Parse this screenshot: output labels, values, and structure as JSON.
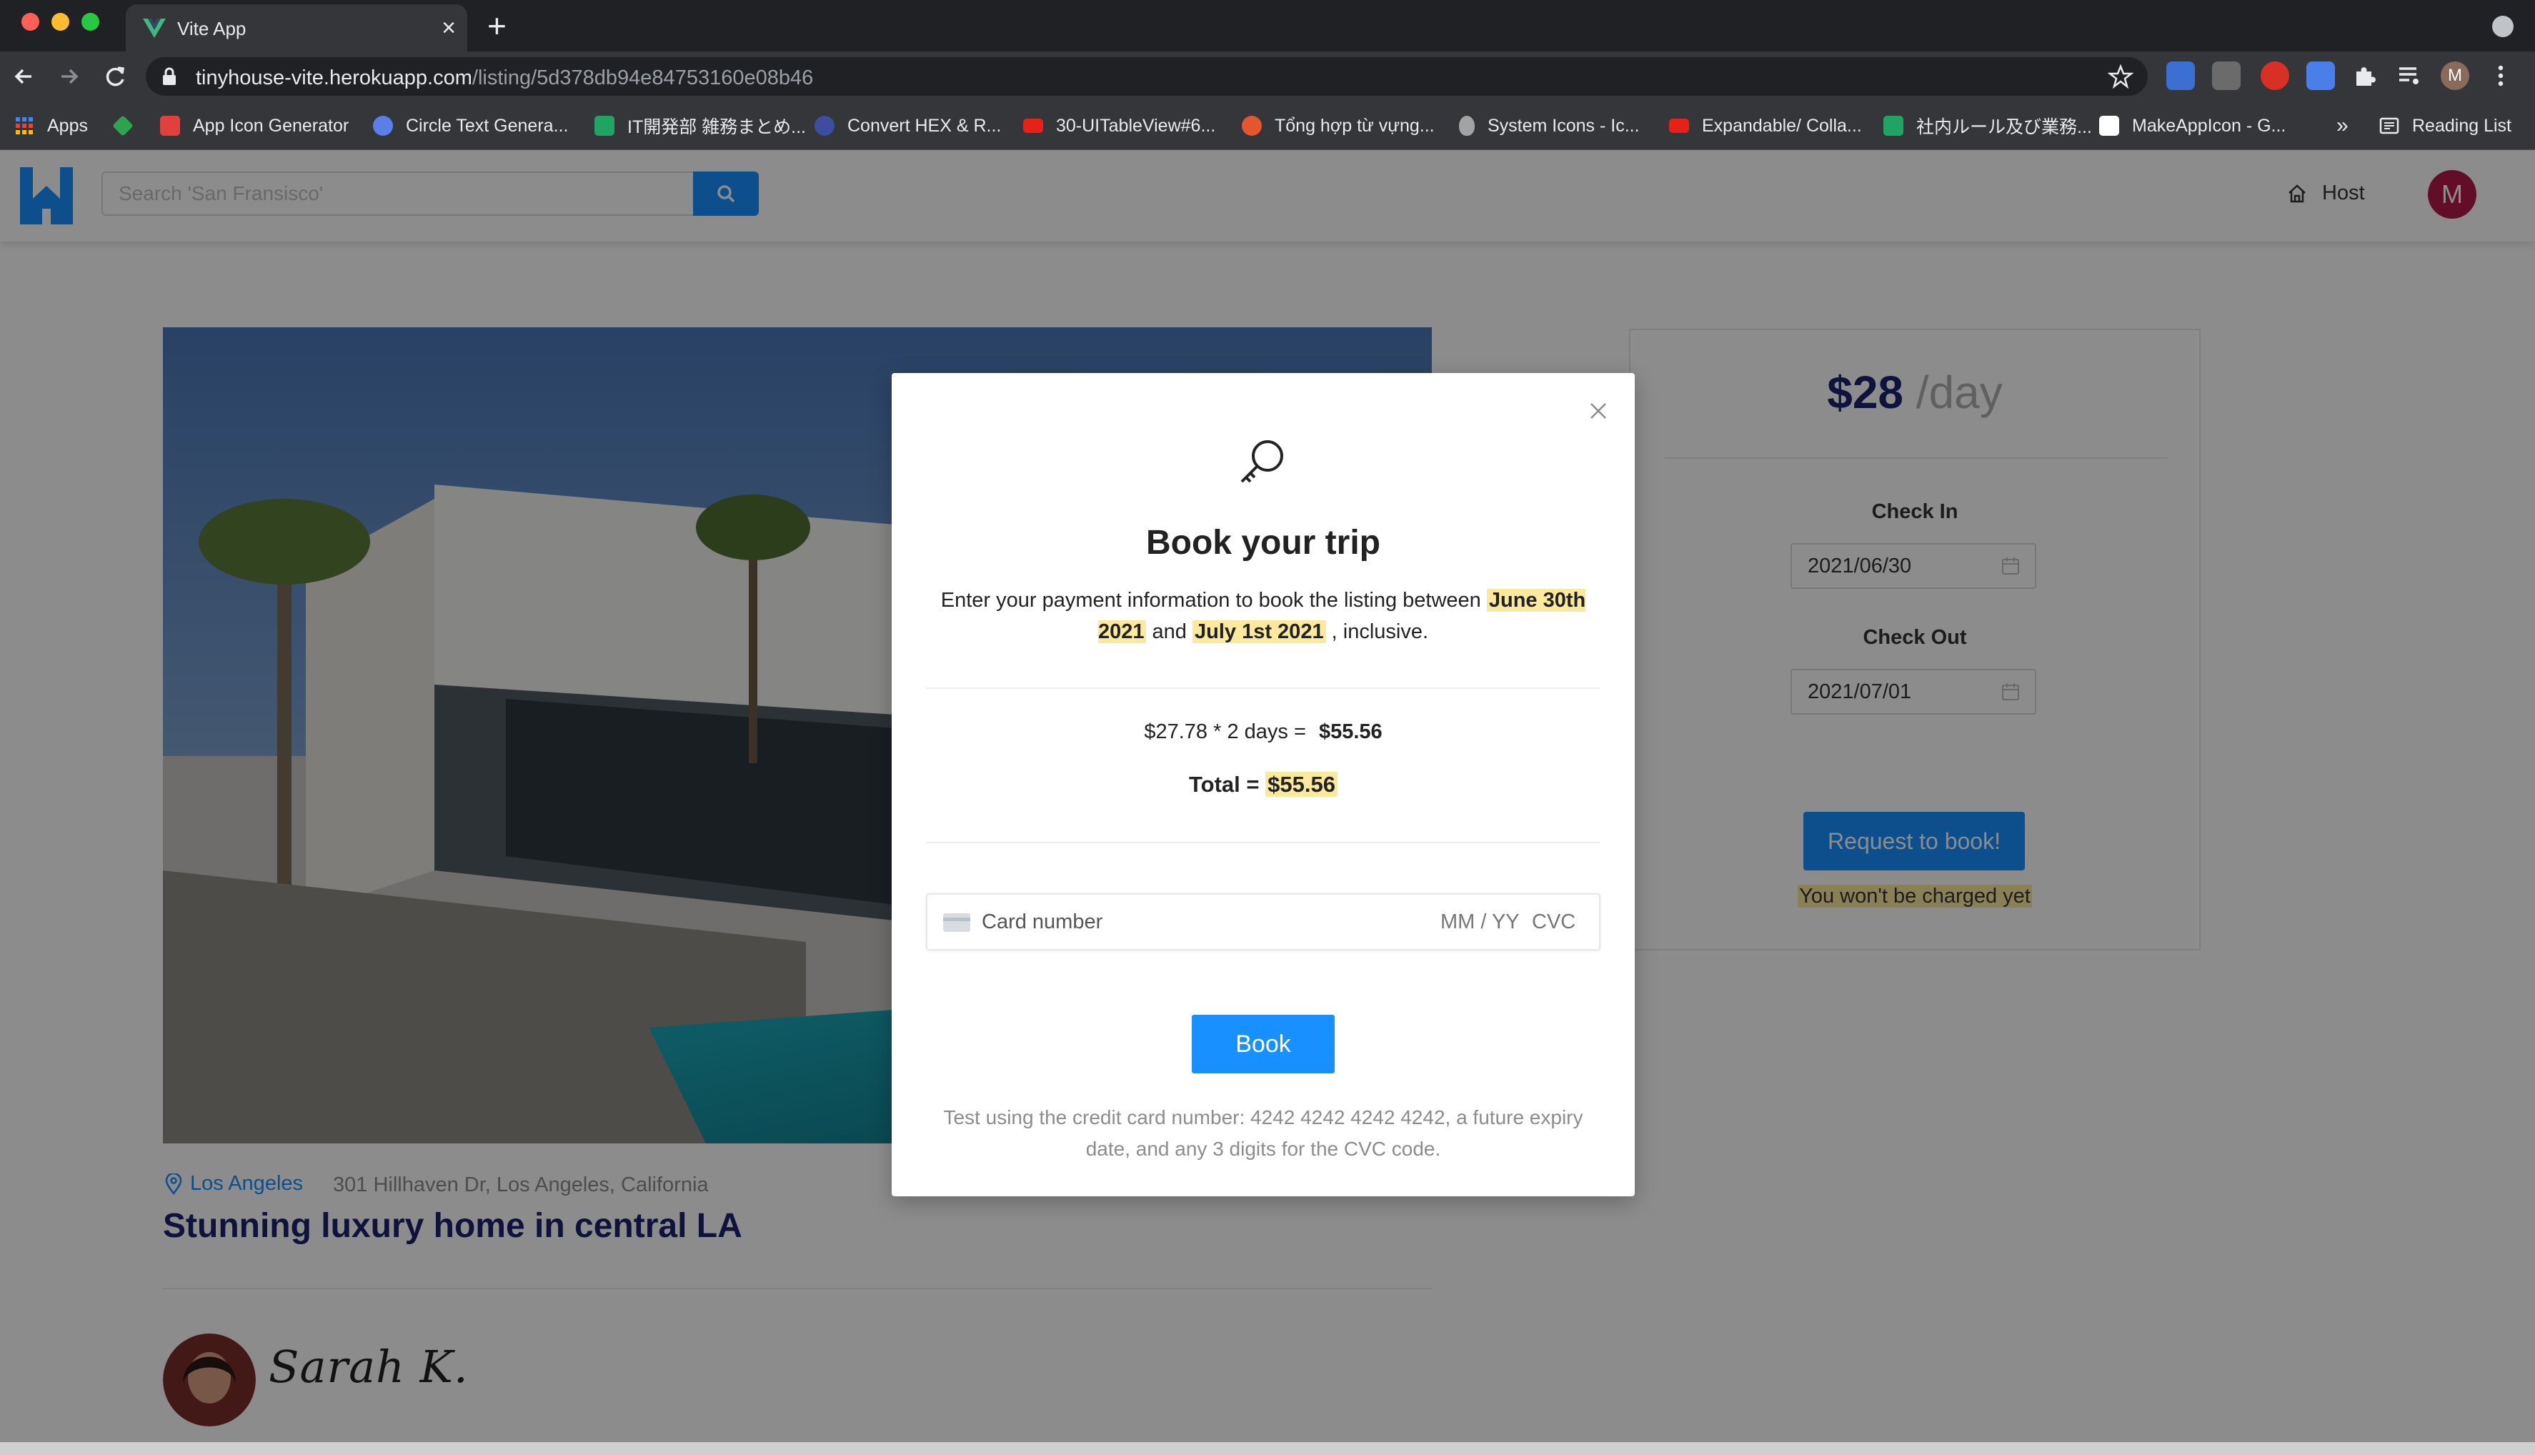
{
  "browser": {
    "tab_title": "Vite App",
    "tab_close": "×",
    "new_tab": "+",
    "url_host": "tinyhouse-vite.herokuapp.com",
    "url_path": "/listing/5d378db94e84753160e08b46",
    "profile_initial": "M"
  },
  "bookmarks": [
    {
      "label": "Apps",
      "icon": "apps-grid-icon",
      "color": "#e8eaed"
    },
    {
      "label": "",
      "icon": "layers-icon",
      "color": "#2ea44f"
    },
    {
      "label": "App Icon Generator",
      "icon": "app-icon-generator-icon",
      "color": "#e0413a"
    },
    {
      "label": "Circle Text Genera...",
      "icon": "circle-text-icon",
      "color": "#5b7fe8"
    },
    {
      "label": "IT開発部 雑務まとめ...",
      "icon": "sheets-icon",
      "color": "#1fa463"
    },
    {
      "label": "Convert HEX & R...",
      "icon": "convert-hex-icon",
      "color": "#3c4ea0"
    },
    {
      "label": "30-UITableView#6...",
      "icon": "youtube-icon",
      "color": "#e62117"
    },
    {
      "label": "Tổng hợp từ vựng...",
      "icon": "tong-hop-icon",
      "color": "#e4572e"
    },
    {
      "label": "System Icons - Ic...",
      "icon": "apple-icon",
      "color": "#a3a3a3"
    },
    {
      "label": "Expandable/ Colla...",
      "icon": "youtube-icon",
      "color": "#e62117"
    },
    {
      "label": "社内ルール及び業務...",
      "icon": "sheets-icon",
      "color": "#1fa463"
    },
    {
      "label": "MakeAppIcon - G...",
      "icon": "makeappicon-icon",
      "color": "#ffffff"
    }
  ],
  "bookmarks_overflow": "»",
  "reading_list": "Reading List",
  "header": {
    "search_placeholder": "Search 'San Fransisco'",
    "host_label": "Host",
    "user_initial": "M",
    "brand_color": "#1890ff"
  },
  "listing": {
    "city": "Los Angeles",
    "address": "301 Hillhaven Dr, Los Angeles, California",
    "title": "Stunning luxury home in central LA",
    "host_name": "Sarah K."
  },
  "booking_card": {
    "price": "$28",
    "price_unit": "/day",
    "check_in_label": "Check In",
    "check_in_value": "2021/06/30",
    "check_out_label": "Check Out",
    "check_out_value": "2021/07/01",
    "request_button": "Request to book!",
    "charge_note": "You won't be charged yet"
  },
  "modal": {
    "title": "Book your trip",
    "desc_prefix": "Enter your payment information to book the listing between",
    "start_date": "June 30th 2021",
    "desc_and": "and",
    "end_date": "July 1st 2021",
    "desc_suffix": ", inclusive.",
    "calc_text": "$27.78 * 2 days =",
    "calc_result": "$55.56",
    "total_label": "Total =",
    "total_value": "$55.56",
    "card_placeholder": "Card number",
    "expiry_placeholder": "MM / YY",
    "cvc_placeholder": "CVC",
    "book_button": "Book",
    "test_note": "Test using the credit card number: 4242 4242 4242 4242, a future expiry date, and any 3 digits for the CVC code."
  }
}
